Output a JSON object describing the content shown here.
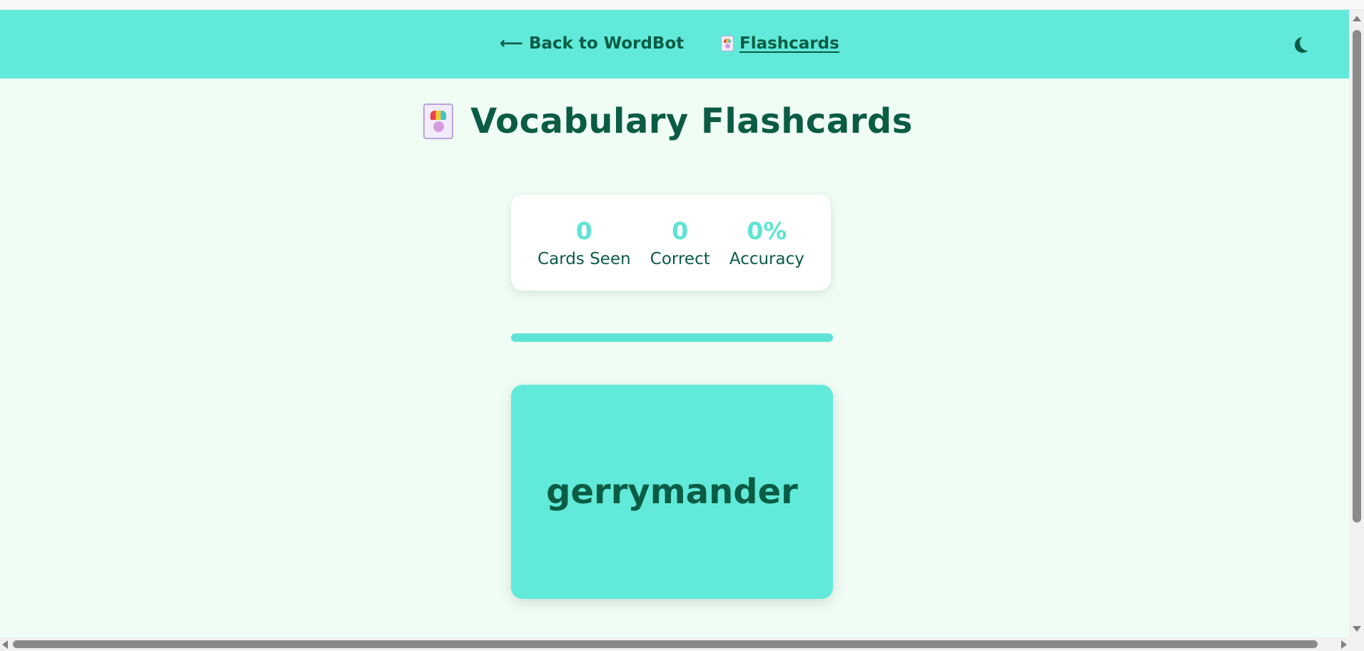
{
  "nav": {
    "back_label": "Back to WordBot",
    "back_arrow": "⟵",
    "flashcards_label": "Flashcards",
    "theme_toggle_icon": "moon-icon"
  },
  "header": {
    "title": "Vocabulary Flashcards",
    "icon": "flashcard-icon"
  },
  "stats": [
    {
      "value": "0",
      "label": "Cards Seen"
    },
    {
      "value": "0",
      "label": "Correct"
    },
    {
      "value": "0%",
      "label": "Accuracy"
    }
  ],
  "progress": {
    "fraction": 1.0
  },
  "card": {
    "word": "gerrymander"
  },
  "colors": {
    "accent": "#61eada",
    "text": "#0b5c44",
    "background": "#effdf5"
  }
}
